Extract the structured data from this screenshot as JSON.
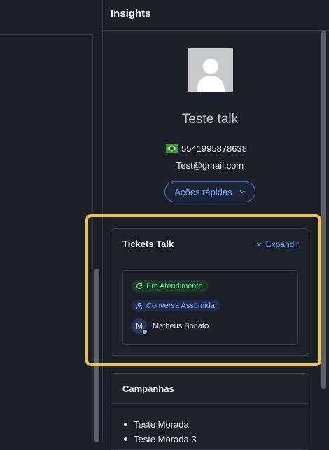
{
  "insights": {
    "title": "Insights"
  },
  "contact": {
    "name": "Teste talk",
    "phone": "5541995878638",
    "phone_flag_icon": "brazil-flag-icon",
    "email": "Test@gmail.com",
    "quick_actions_label": "Ações rápidas"
  },
  "tickets_card": {
    "title": "Tickets Talk",
    "expand_label": "Expandir",
    "status_badge": "Em Atendimento",
    "assignment_badge": "Conversa Assumida",
    "agent_initial": "M",
    "agent_name": "Matheus Bonato"
  },
  "campaigns_card": {
    "title": "Campanhas",
    "items": [
      "Teste Morada",
      "Teste Morada 3"
    ]
  },
  "colors": {
    "accent_blue": "#6ea8ff",
    "status_green": "#4dd77a",
    "highlight_yellow": "#f3c63a"
  }
}
